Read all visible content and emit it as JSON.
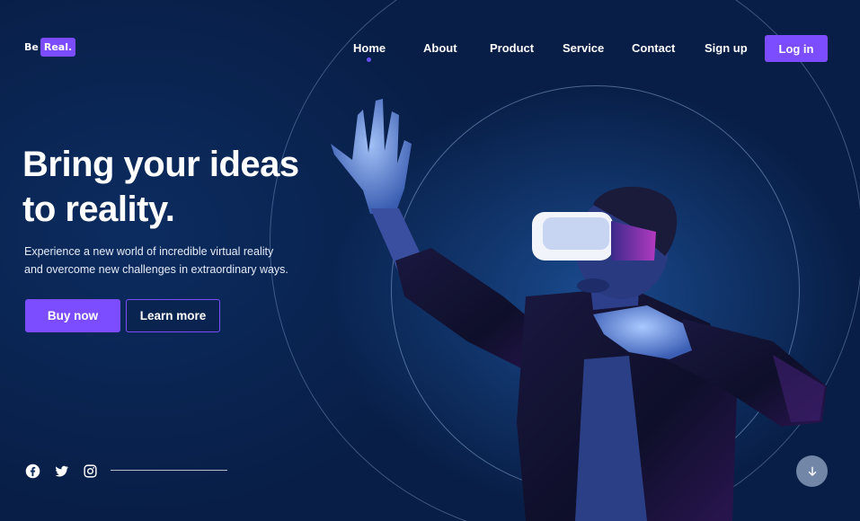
{
  "brand": {
    "prefix": "Be",
    "highlight": "Real."
  },
  "nav": {
    "items": [
      {
        "label": "Home",
        "active": true
      },
      {
        "label": "About"
      },
      {
        "label": "Product"
      },
      {
        "label": "Service"
      },
      {
        "label": "Contact"
      },
      {
        "label": "Sign up"
      }
    ],
    "login_label": "Log in"
  },
  "hero": {
    "title_line1": "Bring your ideas",
    "title_line2": "to reality.",
    "subtitle_line1": "Experience a new world of incredible virtual reality",
    "subtitle_line2": "and overcome new challenges in extraordinary ways.",
    "primary_cta": "Buy now",
    "secondary_cta": "Learn more"
  },
  "socials": [
    "facebook-icon",
    "twitter-icon",
    "instagram-icon"
  ],
  "scroll_icon": "arrow-down-icon",
  "colors": {
    "accent": "#7b4dff",
    "background": "#0b2a5c",
    "text": "#ffffff"
  }
}
